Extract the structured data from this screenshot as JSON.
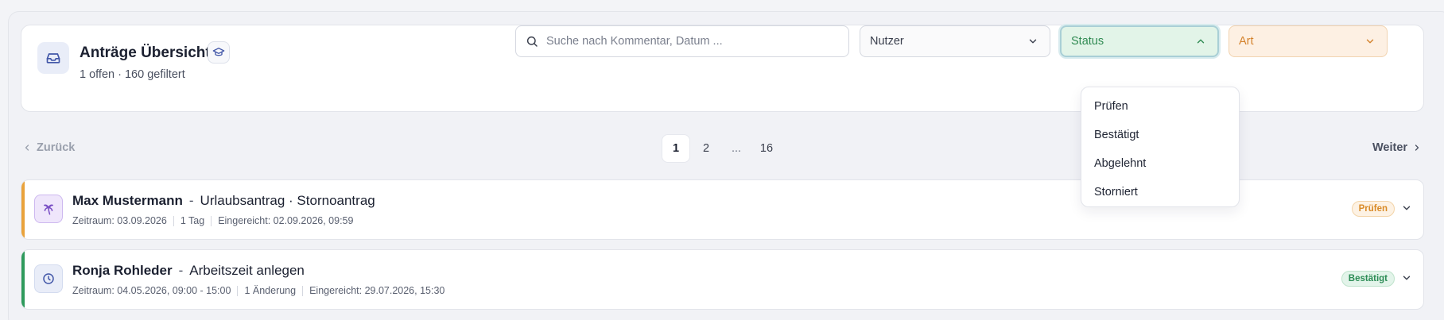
{
  "header": {
    "title": "Anträge Übersicht",
    "subtitle": "1 offen · 160 gefiltert"
  },
  "filters": {
    "search_placeholder": "Suche nach Kommentar, Datum ...",
    "nutzer_label": "Nutzer",
    "status_label": "Status",
    "art_label": "Art"
  },
  "status_dropdown": {
    "options": [
      "Prüfen",
      "Bestätigt",
      "Abgelehnt",
      "Storniert"
    ]
  },
  "pagination": {
    "back_label": "Zurück",
    "next_label": "Weiter",
    "pages": [
      "1",
      "2",
      "...",
      "16"
    ],
    "active_page": "1"
  },
  "requests": [
    {
      "name": "Max Mustermann",
      "dash": "-",
      "type": "Urlaubsantrag · Stornoantrag",
      "zeitraum": "Zeitraum: 03.09.2026",
      "dauer": "1 Tag",
      "eingereicht": "Eingereicht: 02.09.2026, 09:59",
      "status": "Prüfen",
      "accent_color": "#e9a23b",
      "icon": "palm-tree-icon"
    },
    {
      "name": "Ronja Rohleder",
      "dash": "-",
      "type": "Arbeitszeit anlegen",
      "zeitraum": "Zeitraum: 04.05.2026, 09:00 - 15:00",
      "dauer": "1 Änderung",
      "eingereicht": "Eingereicht: 29.07.2026, 15:30",
      "status": "Bestätigt",
      "accent_color": "#2e9a5c",
      "icon": "clock-icon"
    }
  ],
  "colors": {
    "status_green": "#2f8a52",
    "art_orange": "#d4822c",
    "icon_blue": "#4257a8"
  }
}
